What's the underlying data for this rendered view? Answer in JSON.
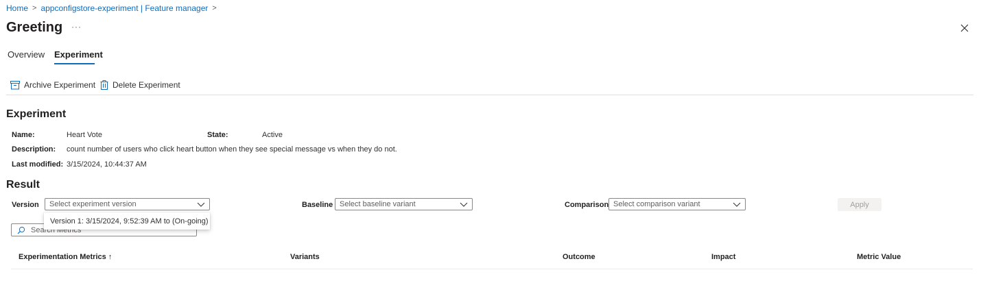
{
  "breadcrumb": {
    "items": [
      "Home",
      "appconfigstore-experiment | Feature manager"
    ]
  },
  "header": {
    "title": "Greeting",
    "more_label": "···"
  },
  "tabs": [
    {
      "label": "Overview",
      "active": false
    },
    {
      "label": "Experiment",
      "active": true
    }
  ],
  "toolbar": {
    "archive_label": "Archive Experiment",
    "delete_label": "Delete Experiment"
  },
  "experiment": {
    "heading": "Experiment",
    "name_label": "Name:",
    "name_value": "Heart Vote",
    "state_label": "State:",
    "state_value": "Active",
    "description_label": "Description:",
    "description_value": "count number of users who click heart button when they see special message vs when they do not.",
    "modified_label": "Last modified:",
    "modified_value": "3/15/2024, 10:44:37 AM"
  },
  "result": {
    "heading": "Result",
    "version_label": "Version",
    "version_placeholder": "Select experiment version",
    "version_options": [
      "Version 1: 3/15/2024, 9:52:39 AM to (On-going)"
    ],
    "baseline_label": "Baseline",
    "baseline_placeholder": "Select baseline variant",
    "comparison_label": "Comparison",
    "comparison_placeholder": "Select comparison variant",
    "apply_label": "Apply",
    "search_placeholder": "Search Metrics"
  },
  "table": {
    "columns": [
      "Experimentation Metrics ↑",
      "Variants",
      "Outcome",
      "Impact",
      "Metric Value"
    ]
  },
  "colors": {
    "accent": "#0f6cbd",
    "text": "#323130",
    "border": "#8a8886"
  }
}
